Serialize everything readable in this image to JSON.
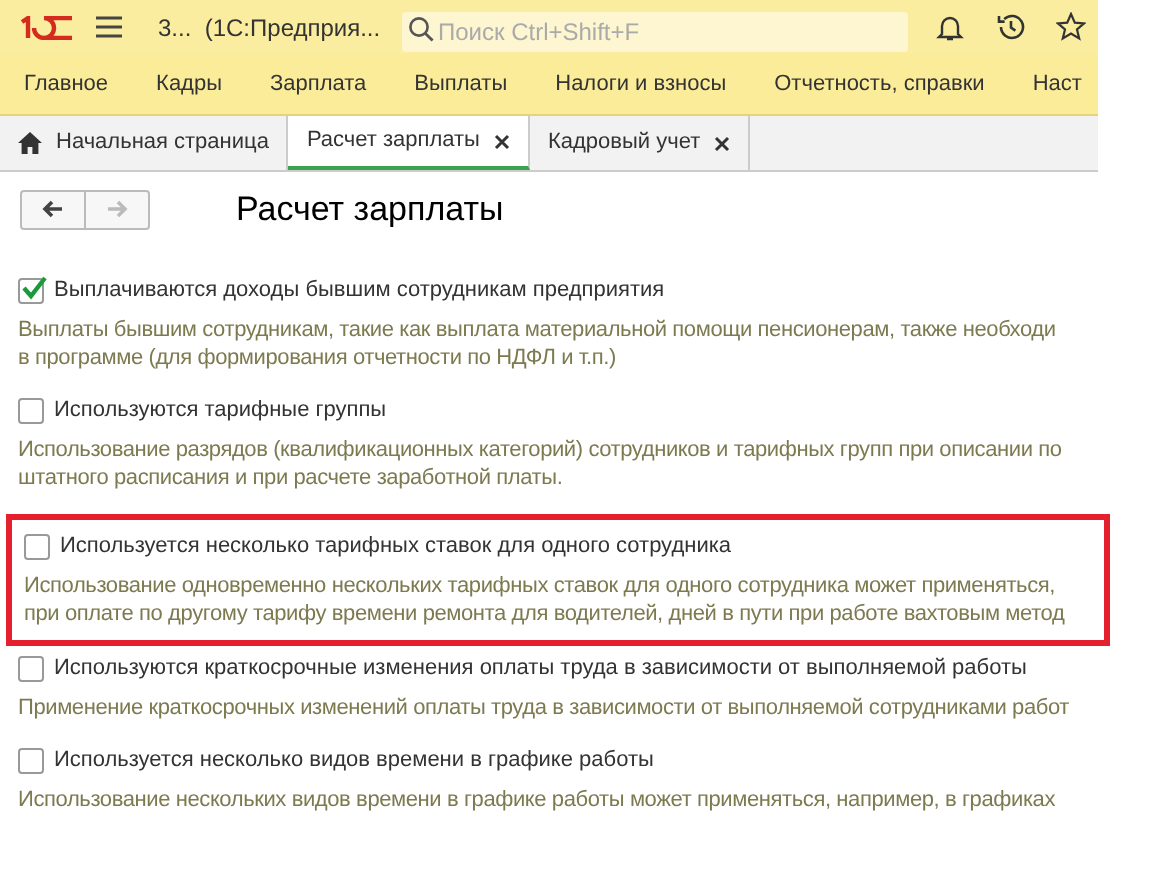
{
  "top_bar": {
    "title": "3...  (1С:Предприя...",
    "search": {
      "placeholder": "Поиск Ctrl+Shift+F"
    }
  },
  "menu": [
    {
      "label": "Главное"
    },
    {
      "label": "Кадры"
    },
    {
      "label": "Зарплата"
    },
    {
      "label": "Выплаты"
    },
    {
      "label": "Налоги и взносы"
    },
    {
      "label": "Отчетность, справки"
    },
    {
      "label": "Наст"
    }
  ],
  "tabs": [
    {
      "label": "Начальная страница",
      "kind": "home",
      "selected": false
    },
    {
      "label": "Расчет зарплаты",
      "kind": "closable",
      "selected": true
    },
    {
      "label": "Кадровый учет",
      "kind": "closable",
      "selected": false
    }
  ],
  "page": {
    "title": "Расчет зарплаты",
    "back_disabled": false,
    "forward_disabled": true
  },
  "options": [
    {
      "label": "Выплачиваются доходы бывшим сотрудникам предприятия",
      "checked": true,
      "highlighted": false,
      "description": [
        "Выплаты бывшим сотрудникам, такие как выплата материальной помощи пенсионерам, также необходи",
        "в программе (для формирования отчетности по НДФЛ и т.п.)"
      ]
    },
    {
      "label": "Используются тарифные группы",
      "checked": false,
      "highlighted": false,
      "description": [
        "Использование разрядов (квалификационных категорий) сотрудников и тарифных групп при описании по",
        "штатного расписания и при расчете заработной платы."
      ]
    },
    {
      "label": "Используется несколько тарифных ставок для одного сотрудника",
      "checked": false,
      "highlighted": true,
      "description": [
        "Использование одновременно нескольких тарифных ставок для одного сотрудника может применяться,",
        "при оплате по другому тарифу времени ремонта для водителей, дней в пути при работе вахтовым метод"
      ]
    },
    {
      "label": "Используются краткосрочные изменения оплаты труда в зависимости от выполняемой работы",
      "checked": false,
      "highlighted": false,
      "description": [
        "Применение краткосрочных изменений оплаты труда в зависимости от выполняемой сотрудниками работ"
      ]
    },
    {
      "label": "Используется несколько видов времени в графике работы",
      "checked": false,
      "highlighted": false,
      "description": [
        "Использование нескольких видов времени в графике работы может применяться, например, в графиках"
      ]
    }
  ]
}
